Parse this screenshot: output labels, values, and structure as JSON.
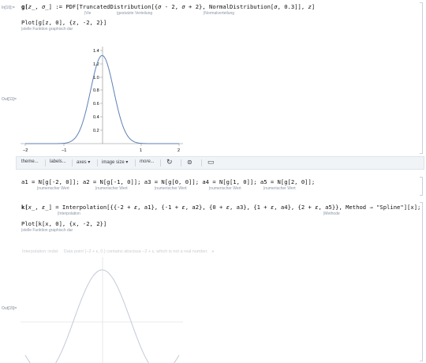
{
  "cell1": {
    "in_label": "In[10]:=",
    "code_line1_a": "g[",
    "code_line1_b": "_, ",
    "code_line1_c": "_] := PDF[TruncatedDistribution[{",
    "code_line1_d": " - 2, ",
    "code_line1_e": " + 2}, NormalDistribution[",
    "code_line1_f": ", 0.3]], ",
    "code_line1_g": "]",
    "var_z": "z",
    "var_sigma": "σ",
    "ann_vie": "|Vie",
    "ann_trunc": "|gestutzte Verteilung",
    "ann_norm": "|Normalverteilung",
    "code_line2": "Plot[g[z, 0], {z, -2, 2}]",
    "ann_plot": "|stelle Funktion graphisch dar",
    "out_label": "Out[11]="
  },
  "plot1": {
    "y_ticks": [
      "1.4",
      "1.2",
      "1.0",
      "0.8",
      "0.6",
      "0.4",
      "0.2"
    ],
    "x_ticks": [
      "−2",
      "−1",
      "1",
      "2"
    ]
  },
  "toolbar": {
    "theme": "theme...",
    "labels": "labels...",
    "axes": "axes",
    "image_size": "image size",
    "more": "more...",
    "icon_refresh": "refresh-icon",
    "icon_shuffle": "shuffle-icon",
    "icon_comment": "comment-icon"
  },
  "cell2": {
    "code": "a1 = N[g[-2, 0]]; a2 = N[g[-1, 0]]; a3 = N[g[0, 0]]; a4 = N[g[1, 0]]; a5 = N[g[2, 0]];",
    "ann_num": "|numerischer Wert"
  },
  "cell3": {
    "code_a": "k[",
    "code_b": "_, ",
    "code_c": "_] = Interpolation[{{-2 + ",
    "code_d": ", a1}, {-1 + ",
    "code_e": ", a2}, {0 + ",
    "code_f": ", a3}, {1 + ",
    "code_g": ", a4}, {2 + ",
    "code_h": ", a5}}, Method → \"Spline\"][x];",
    "var_x": "x",
    "var_e": "ε",
    "ann_interp": "|Interpolation",
    "ann_method": "|Methode",
    "code_line2": "Plot[k[x, 0], {x, -2, 2}]",
    "ann_plot": "|stelle Funktion graphisch dar",
    "message_head": "Interpolation::indat",
    "message_body": "Data point {−2 + ε, 0.} contains abscissa −2 + ε, which is not a real number.",
    "out_label": "Out[15]="
  },
  "plot2": {}
}
